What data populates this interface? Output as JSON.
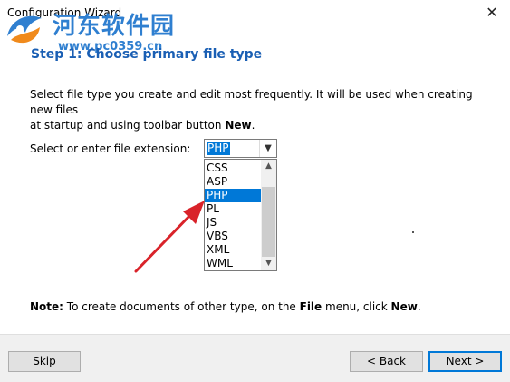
{
  "window": {
    "title": "Configuration Wizard",
    "close_glyph": "✕"
  },
  "watermark": {
    "site_name": "河东软件园",
    "url": "www.pc0359.cn"
  },
  "step": {
    "heading": "Step 1: Choose primary file type",
    "description_line1": "Select file type you create and edit most frequently. It will be used when creating new files",
    "description_line2_prefix": "at startup and using toolbar button ",
    "description_line2_bold": "New",
    "description_line2_suffix": "."
  },
  "extension": {
    "label": "Select or enter file extension:",
    "selected_value": "PHP",
    "options": [
      "CSS",
      "ASP",
      "PHP",
      "PL",
      "JS",
      "VBS",
      "XML",
      "WML"
    ]
  },
  "note": {
    "label": "Note:",
    "text1": " To create documents of other type, on the ",
    "file_word": "File",
    "text2": " menu, click ",
    "new_word": "New",
    "text3": "."
  },
  "buttons": {
    "skip": "Skip",
    "back": "< Back",
    "next": "Next >"
  },
  "colors": {
    "accent": "#0078d7",
    "heading": "#1a5fb4",
    "annotation_arrow": "#d9232a",
    "watermark": "#2f7fd0"
  }
}
